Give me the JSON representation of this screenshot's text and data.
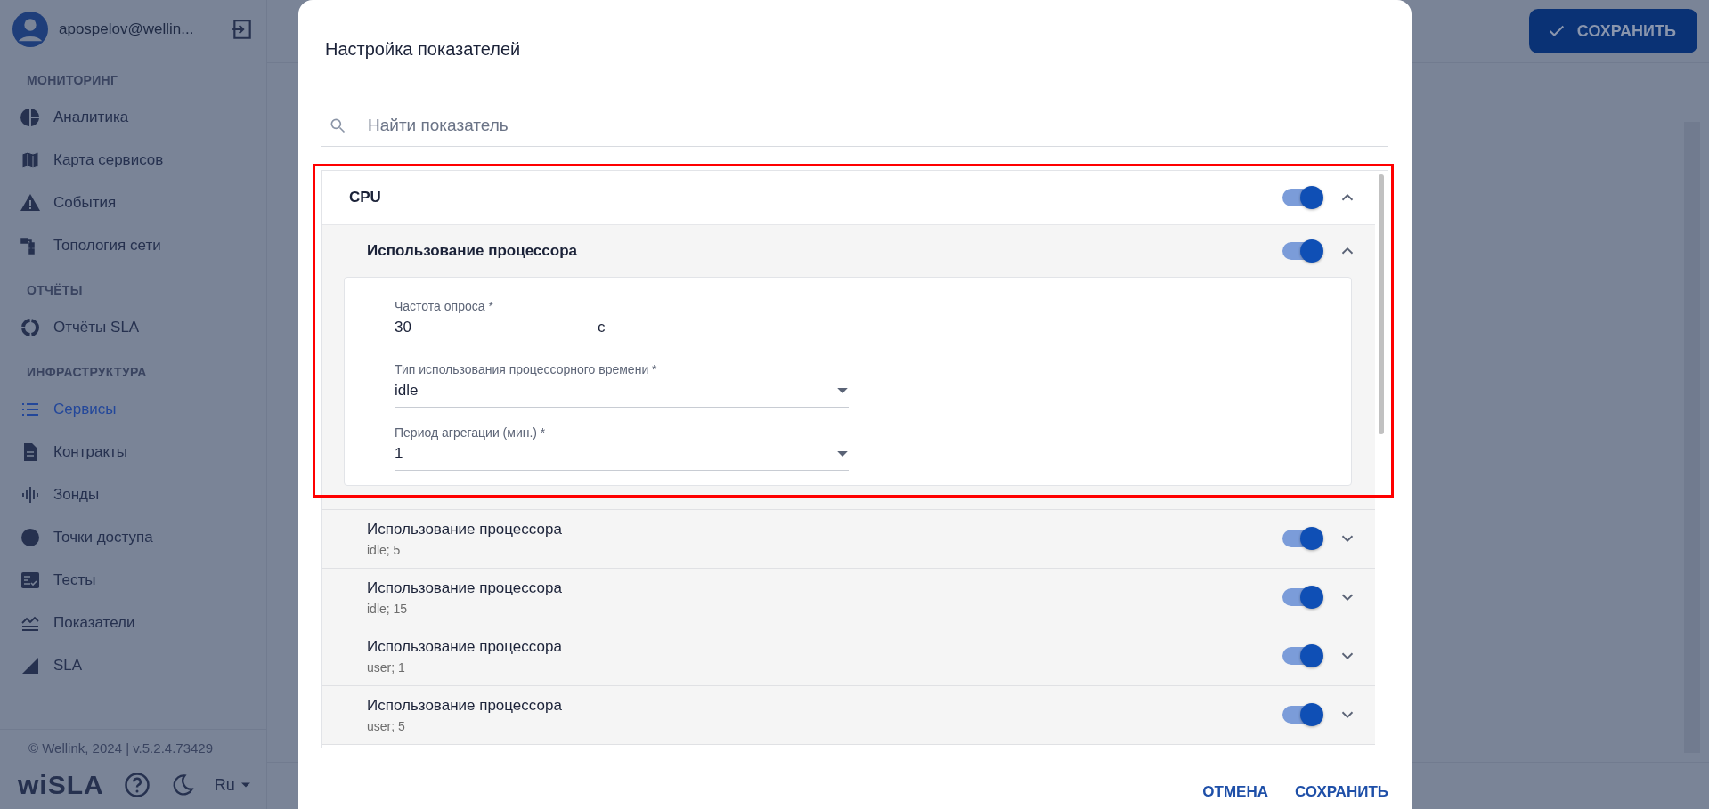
{
  "sidebar": {
    "user": "apospelov@wellin...",
    "sections": [
      {
        "title": "МОНИТОРИНГ",
        "items": [
          {
            "label": "Аналитика",
            "selected": false
          },
          {
            "label": "Карта сервисов",
            "selected": false
          },
          {
            "label": "События",
            "selected": false
          },
          {
            "label": "Топология сети",
            "selected": false
          }
        ]
      },
      {
        "title": "ОТЧЁТЫ",
        "items": [
          {
            "label": "Отчёты SLA",
            "selected": false
          }
        ]
      },
      {
        "title": "ИНФРАСТРУКТУРА",
        "items": [
          {
            "label": "Сервисы",
            "selected": true
          },
          {
            "label": "Контракты",
            "selected": false
          },
          {
            "label": "Зонды",
            "selected": false
          },
          {
            "label": "Точки доступа",
            "selected": false
          },
          {
            "label": "Тесты",
            "selected": false
          },
          {
            "label": "Показатели",
            "selected": false
          },
          {
            "label": "SLA",
            "selected": false
          }
        ]
      }
    ],
    "copyright": "© Wellink, 2024 | v.5.2.4.73429",
    "logo": "wiSLA",
    "language": "Ru"
  },
  "header": {
    "save_button": "СОХРАНИТЬ"
  },
  "dialog": {
    "title": "Настройка показателей",
    "search": {
      "placeholder": "Найти показатель"
    },
    "groups": [
      {
        "name": "CPU",
        "on": true,
        "expanded": true,
        "children": [
          {
            "name": "Использование процессора",
            "on": true,
            "expanded": true,
            "fields": [
              {
                "kind": "number",
                "label": "Частота опроса *",
                "value": "30",
                "unit": "с"
              },
              {
                "kind": "select",
                "label": "Тип использования процессорного времени *",
                "value": "idle"
              },
              {
                "kind": "select",
                "label": "Период агрегации (мин.) *",
                "value": "1"
              }
            ]
          },
          {
            "name": "Использование процессора",
            "detail": "idle; 5",
            "on": true,
            "expanded": false
          },
          {
            "name": "Использование процессора",
            "detail": "idle; 15",
            "on": true,
            "expanded": false
          },
          {
            "name": "Использование процессора",
            "detail": "user; 1",
            "on": true,
            "expanded": false
          },
          {
            "name": "Использование процессора",
            "detail": "user; 5",
            "on": true,
            "expanded": false
          }
        ]
      }
    ],
    "buttons": [
      {
        "label": "ОТМЕНА"
      },
      {
        "label": "СОХРАНИТЬ"
      }
    ]
  }
}
